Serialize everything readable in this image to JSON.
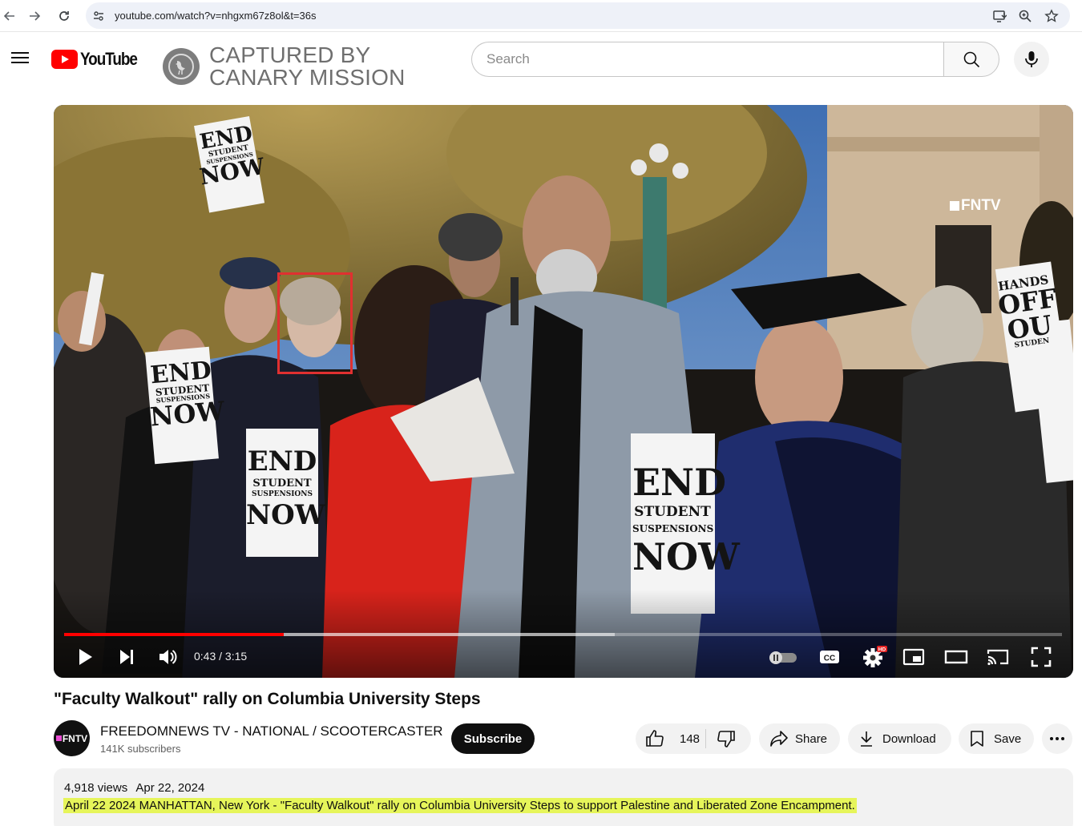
{
  "browser": {
    "url": "youtube.com/watch?v=nhgxm67z8ol&t=36s"
  },
  "header": {
    "logo_text": "YouTube",
    "canary_line1": "CAPTURED BY",
    "canary_line2": "CANARY MISSION",
    "search_placeholder": "Search"
  },
  "player": {
    "watermark": "FNTV",
    "signs": {
      "end": "END",
      "student": "STUDENT",
      "suspensions": "SUSPENSIONS",
      "now": "NOW",
      "hands": "HANDS",
      "off": "OFF",
      "our": "OU",
      "studen": "STUDEN"
    },
    "current_time": "0:43",
    "duration": "3:15",
    "time_text": "0:43 / 3:15",
    "progress_fraction": 0.22,
    "buffered_fraction": 0.552,
    "hd_badge": "HD",
    "cc_label": "CC",
    "colors": {
      "progress": "#ff0000",
      "highlight_box": "#e03030"
    }
  },
  "video": {
    "title": "\"Faculty Walkout\" rally on Columbia University Steps",
    "channel_name": "FREEDOMNEWS TV - NATIONAL / SCOOTERCASTER",
    "channel_avatar_text": "FNTV",
    "subscribers": "141K subscribers",
    "subscribe_label": "Subscribe",
    "likes": "148",
    "share_label": "Share",
    "download_label": "Download",
    "save_label": "Save"
  },
  "description": {
    "views": "4,918 views",
    "date": "Apr 22, 2024",
    "text": "April 22 2024 MANHATTAN, New York - \"Faculty Walkout\" rally on Columbia University Steps  to support Palestine and Liberated Zone Encampment."
  }
}
